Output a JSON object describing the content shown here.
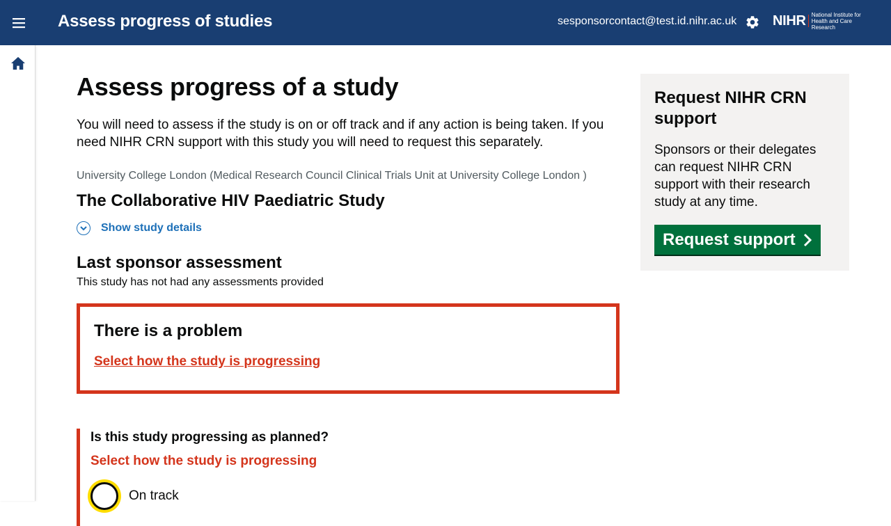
{
  "header": {
    "title": "Assess progress of studies",
    "user_email": "sesponsorcontact@test.id.nihr.ac.uk",
    "logo": {
      "mark": "NIHR",
      "text": "National Institute for Health and Care Research"
    }
  },
  "main": {
    "page_title": "Assess progress of a study",
    "intro": "You will need to assess if the study is on or off track and if any action is being taken. If you need NIHR CRN support with this study you will need to request this separately.",
    "organisation": "University College London (Medical Research Council Clinical Trials Unit at University College London )",
    "study_title": "The Collaborative HIV Paediatric Study",
    "show_details_label": "Show study details",
    "last_assessment_heading": "Last sponsor assessment",
    "last_assessment_text": "This study has not had any assessments provided",
    "error_summary": {
      "title": "There is a problem",
      "link": "Select how the study is progressing"
    },
    "question": {
      "legend": "Is this study progressing as planned?",
      "error": "Select how the study is progressing",
      "options": [
        "On track"
      ]
    }
  },
  "aside": {
    "heading": "Request NIHR CRN support",
    "body": "Sponsors or their delegates can request NIHR CRN support with their research study at any time.",
    "button_label": "Request support"
  },
  "colors": {
    "header_bg": "#193e72",
    "error": "#d4351c",
    "link": "#1d70b8",
    "button_green": "#00703c",
    "focus": "#ffdd00"
  },
  "icons": [
    "menu-icon",
    "gear-icon",
    "home-icon",
    "chevron-down-icon",
    "chevron-right-icon"
  ]
}
